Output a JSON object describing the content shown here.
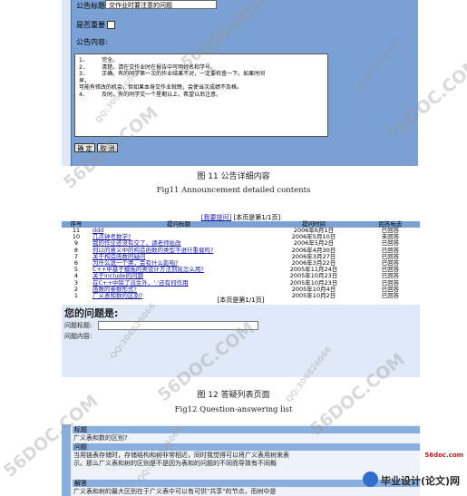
{
  "fig11": {
    "title_label": "公告标题:",
    "title_value": "交作业时要注意的问题",
    "important_label": "是否重要",
    "content_label": "公告内容:",
    "content_text": "1、        完全。\n2、        清楚。请在交作业时在报告中写明姓名和学号。\n3、        正确。有的同学第一次的作业结果不对，一定要检查一下。如果时间\n早，\n可能有修改的机会，但如果本身交作业就晚，会使当次成绩不及格。\n4、        及时。有的同学交一个星期以上，希望以后注意。",
    "ok_button": "确 定",
    "cancel_button": "取 消",
    "caption_cn": "图 11  公告详细内容",
    "caption_en": "Fig11 Announcement detailed contents"
  },
  "fig12": {
    "my_question_link": "[我要提问]",
    "page_info": "[本页是第1/1页]",
    "columns": [
      "序号",
      "提问标题",
      "提问时间",
      "回答标志"
    ],
    "rows": [
      [
        "11",
        "ddd",
        "2006年6月1日",
        "已回答"
      ],
      [
        "10",
        "几点钟考数学?",
        "2006年5月10日",
        "未回答"
      ],
      [
        "9",
        "我的作业还没有交了，请老师批改",
        "2006年5月2日",
        "已回答"
      ],
      [
        "8",
        "何以的意义中的构造函数的类型不进行重载吗?",
        "2006年4月30日",
        "已回答"
      ],
      [
        "7",
        "关于构造函数的疑问",
        "2006年3月27日",
        "已回答"
      ],
      [
        "6",
        "为什么说一个类，会有什么影响?",
        "2006年3月22日",
        "已回答"
      ],
      [
        "5",
        "C++中基于模板的类设计方法到底怎么用?",
        "2005年11月24日",
        "已回答"
      ],
      [
        "4",
        "关于include的问题",
        "2005年10月23日",
        "已回答"
      ],
      [
        "3",
        "在C++中除了派生外，'.'还有何作用",
        "2005年10月23日",
        "已回答"
      ],
      [
        "2",
        "函数的参数形式?",
        "2005年10月4日",
        "已回答"
      ],
      [
        "1",
        "广义表和数的区别?",
        "2005年10月2日",
        "已回答"
      ]
    ],
    "pager_text": "[本页是第1/1页]",
    "question_heading": "您的问题是:",
    "question_title_label": "问题标题:",
    "question_content_label": "问题内容:",
    "caption_cn": "图 12  答疑列表页面",
    "caption_en": "Fig12 Question-answering list"
  },
  "fig13": {
    "title_header": "标题",
    "title_value": "广义表和数的区别?",
    "question_header": "问题",
    "question_line1": "当用链表存储时，存储结构和树非常相近，同时我觉得可以将广义表用树来表",
    "question_line2": "示。那么广义表和树的区别是不是因为表和的问题的不同而导致有不同概",
    "answer_header": "解答",
    "answer_line1": "广义表和树的最大区别在于广义表中可以有可供\"共享\"的节点，而树中是"
  },
  "watermarks": {
    "site": "56DOC.COM",
    "qq": "QQ:306826066"
  },
  "logo": {
    "site": "56doc.com",
    "name": "毕业设计(论文)网"
  }
}
